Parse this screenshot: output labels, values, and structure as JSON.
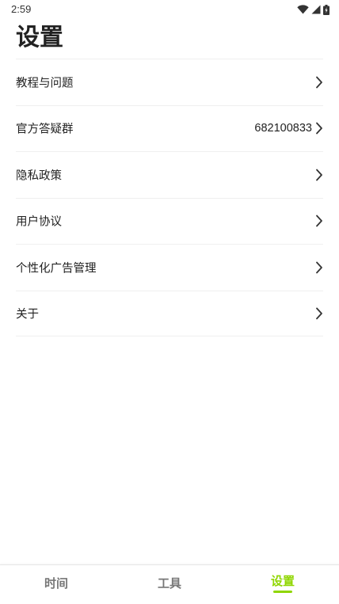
{
  "status_bar": {
    "time": "2:59",
    "icons": [
      "wifi-icon",
      "cell-signal-icon",
      "battery-charging-icon"
    ]
  },
  "page": {
    "title": "设置"
  },
  "settings": {
    "items": [
      {
        "label": "教程与问题",
        "value": "",
        "icon": "chevron-right-icon"
      },
      {
        "label": "官方答疑群",
        "value": "682100833",
        "icon": "chevron-right-icon"
      },
      {
        "label": "隐私政策",
        "value": "",
        "icon": "chevron-right-icon"
      },
      {
        "label": "用户协议",
        "value": "",
        "icon": "chevron-right-icon"
      },
      {
        "label": "个性化广告管理",
        "value": "",
        "icon": "chevron-right-icon"
      },
      {
        "label": "关于",
        "value": "",
        "icon": "chevron-right-icon"
      }
    ]
  },
  "bottom_nav": {
    "tabs": [
      {
        "label": "时间",
        "active": false
      },
      {
        "label": "工具",
        "active": false
      },
      {
        "label": "设置",
        "active": true
      }
    ],
    "active_color": "#8fd600",
    "inactive_color": "#777777"
  }
}
